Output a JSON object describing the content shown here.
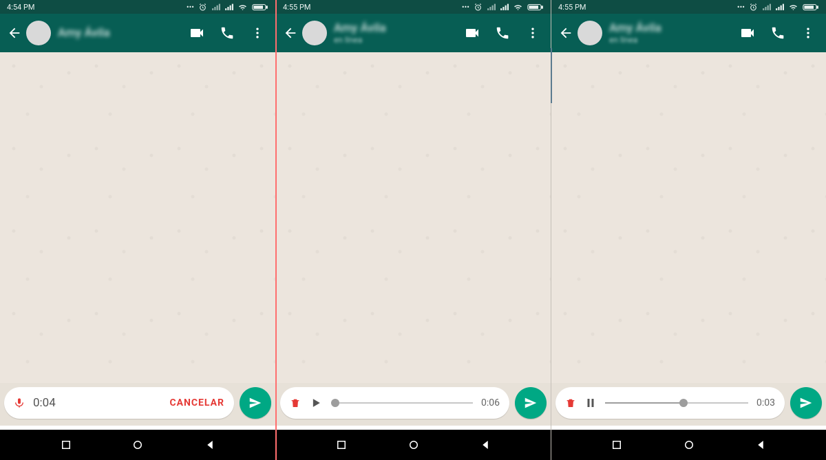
{
  "colors": {
    "header": "#075E54",
    "statusbar": "#0e4d44",
    "send": "#00a884",
    "danger": "#e53935",
    "chat_bg": "#ece5dd"
  },
  "screens": [
    {
      "status": {
        "time": "4:54 PM"
      },
      "header": {
        "name": "Amy Ávila",
        "subtitle": ""
      },
      "footer": {
        "mode": "recording",
        "rec_time": "0:04",
        "cancel_label": "CANCELAR"
      }
    },
    {
      "status": {
        "time": "4:55 PM"
      },
      "header": {
        "name": "Amy Ávila",
        "subtitle": "en línea"
      },
      "footer": {
        "mode": "preview",
        "state": "paused",
        "play_time": "0:06",
        "progress_pct": 3
      }
    },
    {
      "status": {
        "time": "4:55 PM"
      },
      "header": {
        "name": "Amy Ávila",
        "subtitle": "en línea"
      },
      "footer": {
        "mode": "preview",
        "state": "playing",
        "play_time": "0:03",
        "progress_pct": 55
      }
    }
  ]
}
